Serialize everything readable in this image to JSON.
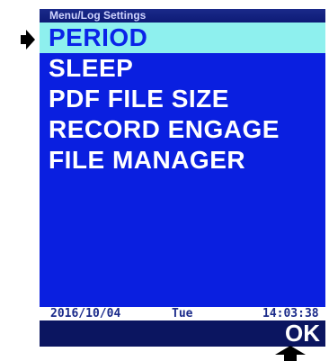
{
  "title_bar": {
    "text": "Menu/Log Settings"
  },
  "menu": {
    "items": [
      {
        "label": "PERIOD",
        "selected": true
      },
      {
        "label": "SLEEP",
        "selected": false
      },
      {
        "label": "PDF  FILE  SIZE",
        "selected": false
      },
      {
        "label": "RECORD ENGAGE",
        "selected": false
      },
      {
        "label": "FILE  MANAGER",
        "selected": false
      }
    ]
  },
  "status": {
    "date": "2016/10/04",
    "day": "Tue",
    "time": "14:03:38"
  },
  "softkey": {
    "ok_label": "OK"
  },
  "icons": {
    "selection_pointer": "right-pointer-arrow-icon",
    "softkey_indicator": "up-arrow-icon"
  },
  "colors": {
    "panel_blue": "#0a1fe0",
    "selection_highlight": "#8ef0ee",
    "softkey_bar": "#0b1560",
    "title_bar": "#0d1a76"
  }
}
